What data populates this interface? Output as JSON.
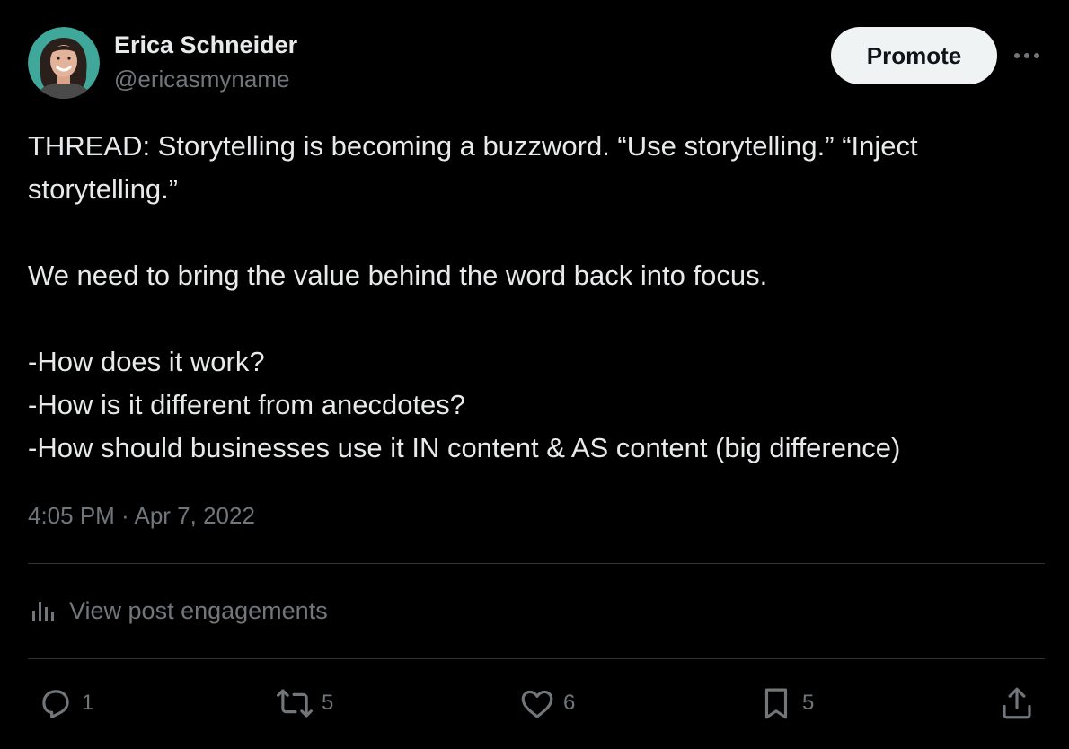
{
  "author": {
    "display_name": "Erica Schneider",
    "handle": "@ericasmyname"
  },
  "header": {
    "promote_label": "Promote",
    "more_icon": "more-horizontal-icon"
  },
  "post": {
    "line1": "THREAD: Storytelling is becoming a buzzword. “Use storytelling.” “Inject",
    "line2": "storytelling.”",
    "line3": "We need to bring the value behind the word back into focus.",
    "line4": "-How does it work?",
    "line5": "-How is it different from anecdotes?",
    "line6": "-How should businesses use it IN content & AS content (big difference)",
    "timestamp": "4:05 PM · Apr 7, 2022"
  },
  "engagements": {
    "label": "View post engagements",
    "icon": "analytics-bars-icon"
  },
  "actions": {
    "reply_count": "1",
    "repost_count": "5",
    "like_count": "6",
    "bookmark_count": "5",
    "reply_icon": "reply-icon",
    "repost_icon": "repost-icon",
    "like_icon": "heart-icon",
    "bookmark_icon": "bookmark-icon",
    "share_icon": "share-icon"
  },
  "colors": {
    "background": "#000000",
    "text_primary": "#e7e9ea",
    "text_secondary": "#71767b",
    "divider": "#2f3336",
    "button_bg": "#eff3f4",
    "button_text": "#0f1419"
  }
}
